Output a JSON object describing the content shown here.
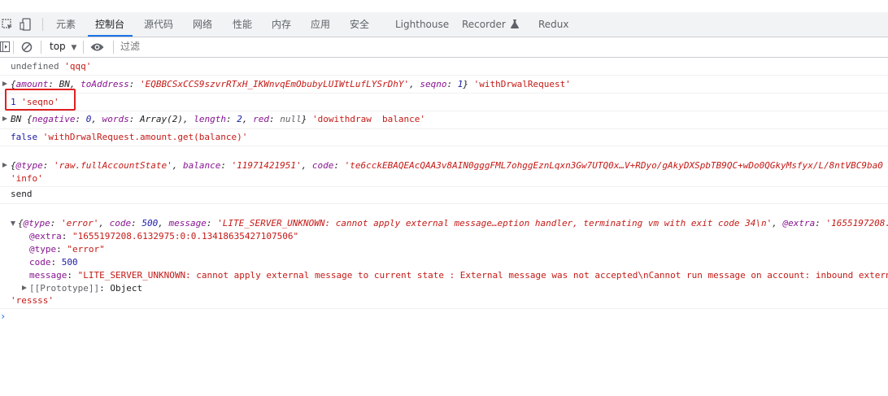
{
  "tabs": [
    "元素",
    "控制台",
    "源代码",
    "网络",
    "性能",
    "内存",
    "应用",
    "安全",
    "Lighthouse",
    "Recorder",
    "Redux"
  ],
  "toolbar": {
    "context": "top",
    "filter_placeholder": "过滤"
  },
  "lines": {
    "undef_a": "undefined ",
    "undef_b": "'qqq'",
    "obj1_open": "{",
    "obj1_k1": "amount",
    "obj1_v1": ": BN, ",
    "obj1_k2": "toAddress",
    "obj1_v2": "'EQBBCSxCCS9szvrRTxH_IKWnvqEmObubyLUIWtLufLYSrDhY'",
    "obj1_k3": "seqno",
    "obj1_v3": "1",
    "obj1_close": "}",
    "obj1_label": "'withDrwalRequest'",
    "seq_num": "1",
    "seq_str": "'seqno'",
    "bn_head": "BN {",
    "bn_k1": "negative",
    "bn_v1": "0",
    "bn_k2": "words",
    "bn_v2": "Array(2)",
    "bn_k3": "length",
    "bn_v3": "2",
    "bn_k4": "red",
    "bn_v4": "null",
    "bn_label": "'dowithdraw  balance'",
    "false_a": "false ",
    "false_b": "'withDrwalRequest.amount.get(balance)'",
    "acc_k1": "@type",
    "acc_v1": "'raw.fullAccountState'",
    "acc_k2": "balance",
    "acc_v2": "'11971421951'",
    "acc_k3": "code",
    "acc_v3": "'te6cckEBAQEAcQAA3v8AIN0gggFML7ohggEznLqxn3Gw7UTQ0x…V+RDyo/gAkyDXSpbTB9QC+wDo0QGkyMsfyx/L/8ntVBC9ba0",
    "info": "'info'",
    "send": "send",
    "err_k1": "@type",
    "err_v1": "'error'",
    "err_k2": "code",
    "err_v2": "500",
    "err_k3": "message",
    "err_v3": "'LITE_SERVER_UNKNOWN: cannot apply external message…eption handler, terminating vm with exit code 34\\n'",
    "err_k4": "@extra",
    "err_v4": "'1655197208.",
    "extra_k": "@extra",
    "extra_v": "\"1655197208.6132975:0:0.13418635427107506\"",
    "type_k": "@type",
    "type_v": "\"error\"",
    "code_k": "code",
    "code_v": "500",
    "message_k": "message",
    "message_v": "\"LITE_SERVER_UNKNOWN: cannot apply external message to current state : External message was not accepted\\nCannot run message on account: inbound extern",
    "proto": "[[Prototype]]",
    "proto_v": "Object",
    "ressss": "'ressss'"
  }
}
